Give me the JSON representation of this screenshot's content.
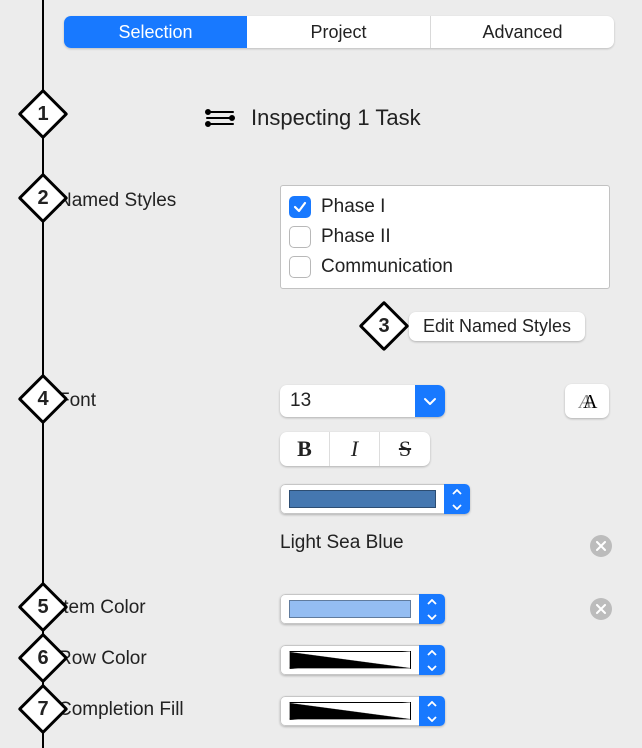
{
  "tabs": {
    "selection": "Selection",
    "project": "Project",
    "advanced": "Advanced"
  },
  "markers": [
    "1",
    "2",
    "3",
    "4",
    "5",
    "6",
    "7"
  ],
  "header": {
    "title": "Inspecting 1 Task"
  },
  "labels": {
    "named_styles": "Named Styles",
    "font": "Font",
    "item_color": "Item Color",
    "row_color": "Row Color",
    "completion_fill": "Completion Fill"
  },
  "named_styles": {
    "items": [
      {
        "label": "Phase I",
        "checked": true
      },
      {
        "label": "Phase II",
        "checked": false
      },
      {
        "label": "Communication",
        "checked": false
      }
    ],
    "edit_button": "Edit Named Styles"
  },
  "font": {
    "size": "13",
    "color_name": "Light Sea Blue",
    "swatch": "#4577b0"
  },
  "item_color": {
    "swatch": "#94bdf2"
  },
  "row_color": {
    "swatch_gradient": true
  },
  "completion_fill": {
    "swatch_gradient": true
  }
}
